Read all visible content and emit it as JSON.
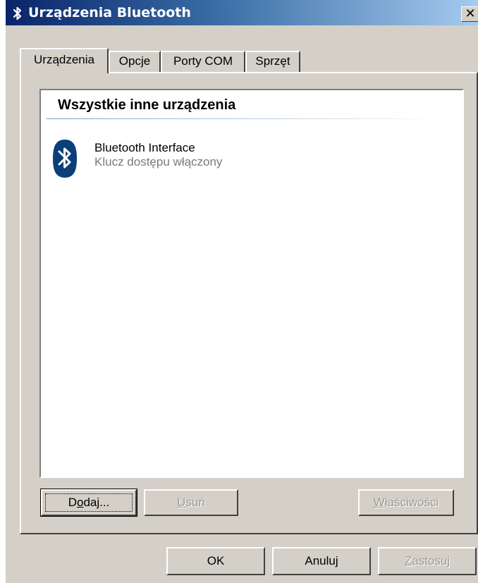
{
  "window": {
    "title": "Urządzenia Bluetooth",
    "close_glyph": "✕"
  },
  "tabs": [
    {
      "label": "Urządzenia",
      "active": true
    },
    {
      "label": "Opcje",
      "active": false
    },
    {
      "label": "Porty COM",
      "active": false
    },
    {
      "label": "Sprzęt",
      "active": false
    }
  ],
  "list": {
    "group_header": "Wszystkie inne urządzenia",
    "items": [
      {
        "name": "Bluetooth Interface",
        "status": "Klucz dostępu włączony",
        "icon": "bluetooth-icon"
      }
    ]
  },
  "panel_buttons": {
    "add": {
      "accel": "o",
      "before": "D",
      "after": "daj...",
      "enabled": true
    },
    "remove": {
      "accel": "U",
      "before": "",
      "after": "suń",
      "enabled": false
    },
    "properties": {
      "accel": "W",
      "before": "",
      "after": "łaściwości",
      "enabled": false
    }
  },
  "dialog_buttons": {
    "ok": "OK",
    "cancel": "Anuluj",
    "apply": {
      "accel": "Z",
      "after": "astosuj",
      "enabled": false
    }
  },
  "colors": {
    "titlebar_start": "#0a246a",
    "titlebar_end": "#a6caf0",
    "face": "#d4d0c8",
    "bluetooth_blue": "#0b3f7a",
    "disabled_text": "#9c9a94",
    "status_gray": "#7a7a7a"
  }
}
